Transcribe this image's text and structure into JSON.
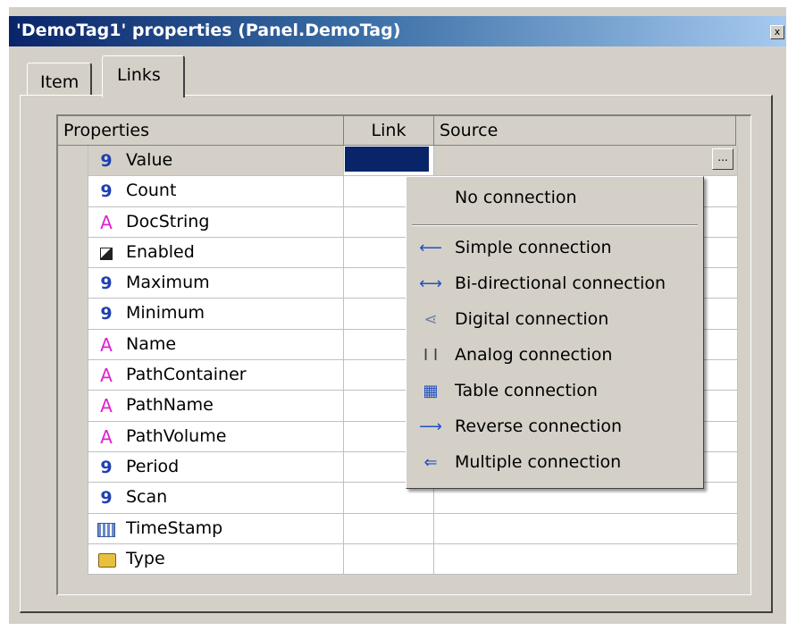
{
  "window": {
    "title": "'DemoTag1' properties (Panel.DemoTag)",
    "close_label": "x"
  },
  "tabs": [
    {
      "label": "Item",
      "active": false
    },
    {
      "label": "Links",
      "active": true
    }
  ],
  "grid": {
    "headers": {
      "properties": "Properties",
      "link": "Link",
      "source": "Source"
    },
    "rows": [
      {
        "name": "Value",
        "icon": "number-icon",
        "glyph": "9"
      },
      {
        "name": "Count",
        "icon": "number-icon",
        "glyph": "9"
      },
      {
        "name": "DocString",
        "icon": "string-icon",
        "glyph": "A"
      },
      {
        "name": "Enabled",
        "icon": "boolean-icon",
        "glyph": ""
      },
      {
        "name": "Maximum",
        "icon": "number-icon",
        "glyph": "9"
      },
      {
        "name": "Minimum",
        "icon": "number-icon",
        "glyph": "9"
      },
      {
        "name": "Name",
        "icon": "string-icon",
        "glyph": "A"
      },
      {
        "name": "PathContainer",
        "icon": "string-icon",
        "glyph": "A"
      },
      {
        "name": "PathName",
        "icon": "string-icon",
        "glyph": "A"
      },
      {
        "name": "PathVolume",
        "icon": "string-icon",
        "glyph": "A"
      },
      {
        "name": "Period",
        "icon": "number-icon",
        "glyph": "9"
      },
      {
        "name": "Scan",
        "icon": "number-icon",
        "glyph": "9"
      },
      {
        "name": "TimeStamp",
        "icon": "timestamp-icon",
        "glyph": ""
      },
      {
        "name": "Type",
        "icon": "type-icon",
        "glyph": ""
      }
    ],
    "ellipsis_label": "..."
  },
  "menu": {
    "no_connection": "No connection",
    "items": [
      {
        "label": "Simple connection",
        "icon": "left-arrow-icon",
        "glyph": "⟵"
      },
      {
        "label": "Bi-directional connection",
        "icon": "bidirectional-arrow-icon",
        "glyph": "⟷"
      },
      {
        "label": "Digital connection",
        "icon": "digital-connection-icon",
        "glyph": "⋖"
      },
      {
        "label": "Analog connection",
        "icon": "analog-connection-icon",
        "glyph": "I I"
      },
      {
        "label": "Table connection",
        "icon": "table-icon",
        "glyph": "▦"
      },
      {
        "label": "Reverse connection",
        "icon": "right-arrow-icon",
        "glyph": "⟶"
      },
      {
        "label": "Multiple connection",
        "icon": "multiple-connection-icon",
        "glyph": "⇐"
      }
    ]
  },
  "colors": {
    "title_start": "#0a246a",
    "title_end": "#a6caf0",
    "selection": "#0a246a",
    "number_icon": "#2040b0",
    "string_icon": "#e020d0",
    "face": "#d4d0c8"
  }
}
